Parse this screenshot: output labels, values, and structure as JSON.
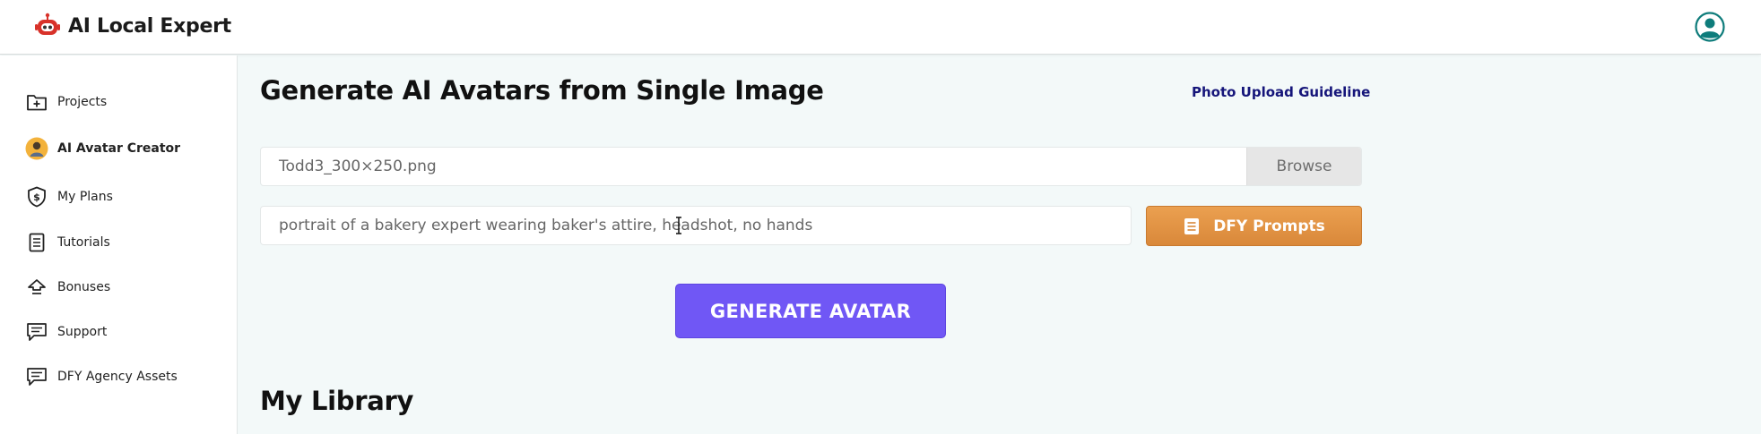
{
  "header": {
    "app_name": "AI Local Expert",
    "logo_icon": "robot-logo-icon",
    "profile_icon": "user-avatar-icon"
  },
  "sidebar": {
    "items": [
      {
        "label": "Projects",
        "icon": "folder-plus-icon",
        "active": false
      },
      {
        "label": "AI Avatar Creator",
        "icon": "avatar-person-icon",
        "active": true
      },
      {
        "label": "My Plans",
        "icon": "dollar-shield-icon",
        "active": false
      },
      {
        "label": "Tutorials",
        "icon": "document-icon",
        "active": false
      },
      {
        "label": "Bonuses",
        "icon": "upload-arrow-icon",
        "active": false
      },
      {
        "label": "Support",
        "icon": "chat-lines-icon",
        "active": false
      },
      {
        "label": "DFY Agency Assets",
        "icon": "chat-lines-icon",
        "active": false
      }
    ]
  },
  "main": {
    "title": "Generate AI Avatars from Single Image",
    "guideline_link": "Photo Upload Guideline",
    "file_upload": {
      "file_name": "Todd3_300×250.png",
      "browse_label": "Browse"
    },
    "prompt": {
      "value": "portrait of a bakery expert wearing baker's attire, headshot, no hands"
    },
    "dfy_prompts_label": "DFY Prompts",
    "generate_label": "GENERATE AVATAR",
    "library_title": "My Library"
  },
  "colors": {
    "accent_purple": "#7057f5",
    "accent_orange": "#e0913f",
    "link_navy": "#15157a",
    "background": "#f3f9f9"
  }
}
